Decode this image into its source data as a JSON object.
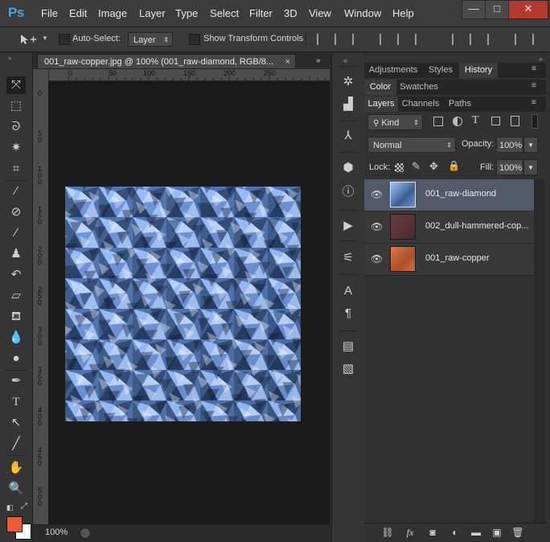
{
  "app": {
    "logo": "Ps"
  },
  "menu": [
    "File",
    "Edit",
    "Image",
    "Layer",
    "Type",
    "Select",
    "Filter",
    "3D",
    "View",
    "Window",
    "Help"
  ],
  "window_controls": {
    "minimize": "—",
    "maximize": "□",
    "close": "✕"
  },
  "options_bar": {
    "auto_select_label": "Auto-Select:",
    "auto_select_value": "Layer",
    "show_transform_label": "Show Transform Controls"
  },
  "document": {
    "tab_title": "001_raw-copper.jpg @ 100% (001_raw-diamond, RGB/8...",
    "ruler_h_ticks": [
      "0",
      "50",
      "100",
      "150",
      "200",
      "250"
    ],
    "ruler_v_ticks": [
      "0",
      "5 0",
      "1 0 0",
      "1 5 0",
      "2 0 0",
      "2 5 0",
      "3 0 0",
      "3 5 0",
      "4 0 0",
      "4 5 0",
      "5 0 0"
    ],
    "zoom": "100%"
  },
  "panels": {
    "row1_tabs": [
      "Adjustments",
      "Styles",
      "History"
    ],
    "row1_active": "History",
    "row2_tabs": [
      "Color",
      "Swatches"
    ],
    "row2_active": "Color",
    "row3_tabs": [
      "Layers",
      "Channels",
      "Paths"
    ],
    "row3_active": "Layers",
    "filter_kind": "Kind",
    "blend_mode": "Normal",
    "opacity_label": "Opacity:",
    "opacity_value": "100%",
    "lock_label": "Lock:",
    "fill_label": "Fill:",
    "fill_value": "100%"
  },
  "layers": [
    {
      "name": "001_raw-diamond",
      "active": true,
      "thumb_color": "#5c86c4"
    },
    {
      "name": "002_dull-hammered-cop...",
      "active": false,
      "thumb_color": "#5a3438"
    },
    {
      "name": "001_raw-copper",
      "active": false,
      "thumb_color": "#c8683a"
    }
  ],
  "colors": {
    "foreground": "#ef5a35",
    "background": "#ffffff",
    "accent": "#4fa3e0"
  },
  "icons": {
    "tools": [
      "move-icon",
      "marquee-icon",
      "lasso-icon",
      "magic-wand-icon",
      "crop-icon",
      "eyedropper-icon",
      "healing-brush-icon",
      "brush-icon",
      "clone-stamp-icon",
      "history-brush-icon",
      "eraser-icon",
      "paint-bucket-icon",
      "blur-icon",
      "dodge-icon",
      "pen-icon",
      "type-icon",
      "path-selection-icon",
      "line-icon",
      "hand-icon",
      "zoom-icon"
    ],
    "dock": [
      "compass-icon",
      "histogram-icon",
      "brush-presets-icon",
      "3d-icon",
      "info-icon",
      "play-actions-icon",
      "properties-icon",
      "character-icon",
      "paragraph-icon",
      "notes-icon",
      "document-icon"
    ],
    "footer": [
      "link-icon",
      "fx-icon",
      "mask-icon",
      "adjustment-icon",
      "folder-icon",
      "new-layer-icon",
      "trash-icon"
    ]
  }
}
